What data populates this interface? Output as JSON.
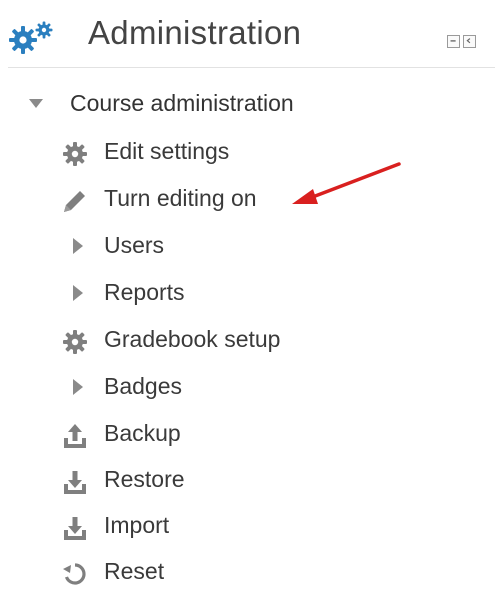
{
  "block": {
    "title": "Administration",
    "icon": "gears-icon",
    "controls": [
      {
        "name": "hide-block-icon"
      },
      {
        "name": "dock-block-icon"
      }
    ]
  },
  "tree": {
    "root": {
      "label": "Course administration",
      "toggle_icon": "caret-down-icon"
    },
    "items": [
      {
        "label": "Edit settings",
        "icon": "gear-icon"
      },
      {
        "label": "Turn editing on",
        "icon": "pencil-icon"
      },
      {
        "label": "Users",
        "icon": "caret-right-icon"
      },
      {
        "label": "Reports",
        "icon": "caret-right-icon"
      },
      {
        "label": "Gradebook setup",
        "icon": "gear-icon"
      },
      {
        "label": "Badges",
        "icon": "caret-right-icon"
      },
      {
        "label": "Backup",
        "icon": "upload-icon"
      },
      {
        "label": "Restore",
        "icon": "download-icon"
      },
      {
        "label": "Import",
        "icon": "download-icon"
      },
      {
        "label": "Reset",
        "icon": "reset-icon"
      }
    ]
  },
  "annotation": {
    "arrow_color": "#d9201f",
    "points_to": "Turn editing on"
  },
  "colors": {
    "icon_gray": "#7f7f7f",
    "gears_blue": "#2b7fbf",
    "text": "#3a3a3a"
  }
}
